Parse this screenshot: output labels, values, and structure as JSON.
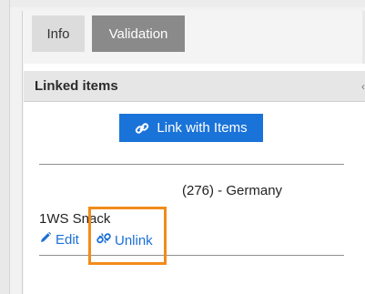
{
  "tabs": [
    {
      "label": "Info",
      "active": true
    },
    {
      "label": "Validation",
      "active": false
    }
  ],
  "section": {
    "title": "Linked items"
  },
  "link_button": {
    "label": "Link with Items",
    "icon": "link-icon",
    "color": "#1a73d8"
  },
  "item": {
    "country": "(276) - Germany",
    "name": "1WS Snack",
    "edit_label": "Edit",
    "edit_icon": "pencil-icon",
    "unlink_label": "Unlink",
    "unlink_icon": "broken-link-icon"
  },
  "highlight_color": "#f28c1b"
}
